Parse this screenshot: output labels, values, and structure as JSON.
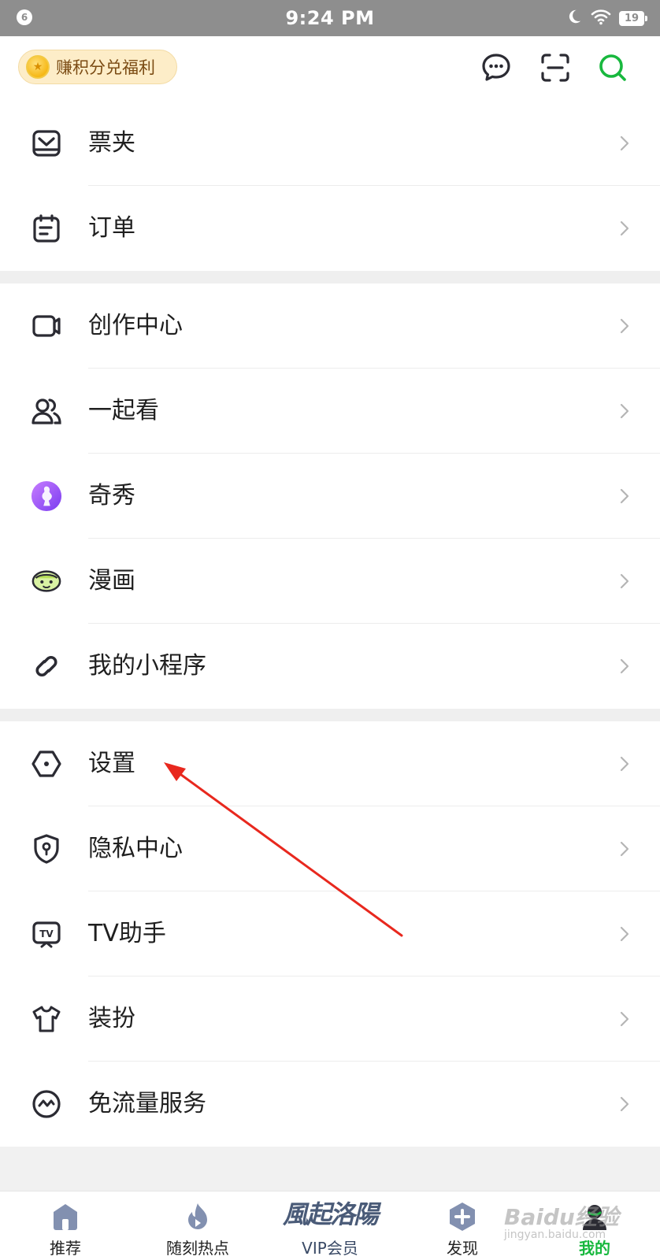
{
  "status_bar": {
    "notification_count": "6",
    "time": "9:24 PM",
    "battery": "19"
  },
  "header": {
    "points_label": "赚积分兑福利"
  },
  "menu_groups": [
    {
      "items": [
        {
          "label": "票夹",
          "icon": "ticket-wallet-icon"
        },
        {
          "label": "订单",
          "icon": "order-icon"
        }
      ]
    },
    {
      "items": [
        {
          "label": "创作中心",
          "icon": "video-camera-icon"
        },
        {
          "label": "一起看",
          "icon": "watch-together-icon"
        },
        {
          "label": "奇秀",
          "icon": "qixiu-icon"
        },
        {
          "label": "漫画",
          "icon": "comic-icon"
        },
        {
          "label": "我的小程序",
          "icon": "mini-program-icon"
        }
      ]
    },
    {
      "items": [
        {
          "label": "设置",
          "icon": "settings-icon"
        },
        {
          "label": "隐私中心",
          "icon": "privacy-shield-icon"
        },
        {
          "label": "TV助手",
          "icon": "tv-assistant-icon"
        },
        {
          "label": "装扮",
          "icon": "tshirt-icon"
        },
        {
          "label": "免流量服务",
          "icon": "free-data-icon"
        }
      ]
    }
  ],
  "tab_bar": {
    "tabs": [
      {
        "label": "推荐",
        "icon": "home-icon",
        "active": false
      },
      {
        "label": "随刻热点",
        "icon": "flame-icon",
        "active": false
      },
      {
        "label": "VIP会员",
        "icon": "vip-logo-icon",
        "logo_text": "風起洛陽",
        "active": false
      },
      {
        "label": "发现",
        "icon": "discover-plus-icon",
        "active": false
      },
      {
        "label": "我的",
        "icon": "profile-icon",
        "active": true
      }
    ]
  },
  "watermark": {
    "brand": "Baidu经验",
    "url": "jingyan.baidu.com"
  },
  "colors": {
    "accent_green": "#18b83e",
    "annotation_red": "#e8281e",
    "status_bar_gray": "#8e8e8e"
  }
}
